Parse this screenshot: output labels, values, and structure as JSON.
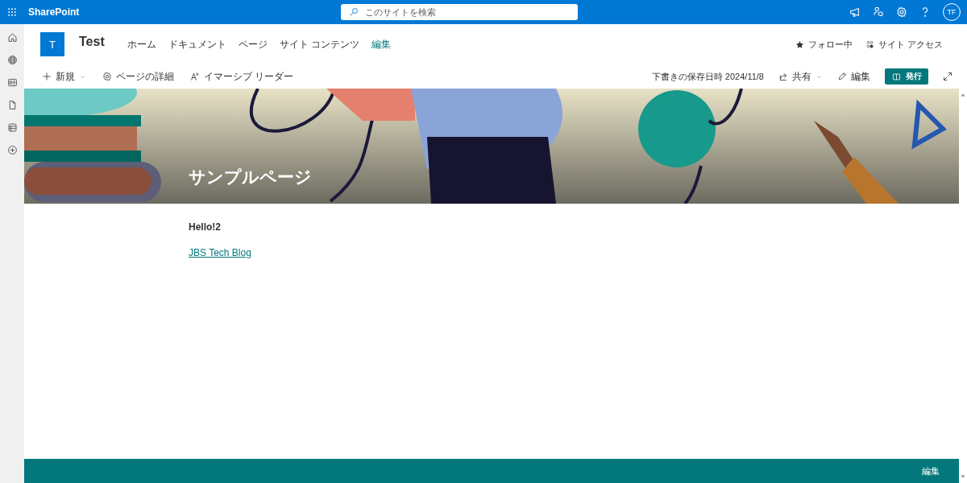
{
  "app_bar": {
    "brand": "SharePoint",
    "search": {
      "placeholder": "このサイトを検索"
    },
    "avatar": "TF"
  },
  "site": {
    "logo_letter": "T",
    "title": "Test",
    "nav": [
      {
        "label": "ホーム",
        "selected": false
      },
      {
        "label": "ドキュメント",
        "selected": false
      },
      {
        "label": "ページ",
        "selected": false
      },
      {
        "label": "サイト コンテンツ",
        "selected": false
      },
      {
        "label": "編集",
        "selected": true
      }
    ],
    "actions": [
      {
        "kind": "follow",
        "label": "フォロー中"
      },
      {
        "kind": "access",
        "label": "サイト アクセス"
      }
    ]
  },
  "command_bar": {
    "left": [
      {
        "kind": "new",
        "label": "新規",
        "dropdown": true
      },
      {
        "kind": "details",
        "label": "ページの詳細",
        "dropdown": false
      },
      {
        "kind": "reader",
        "label": "イマーシブ リーダー",
        "dropdown": false
      }
    ],
    "saved": "下書きの保存日時 2024/11/8",
    "right": [
      {
        "kind": "share",
        "label": "共有",
        "dropdown": true
      },
      {
        "kind": "edit",
        "label": "編集",
        "dropdown": false
      }
    ],
    "publish": "発行"
  },
  "hero": {
    "kind": "picture",
    "title": "サンプルページ"
  },
  "content": [
    {
      "kind": "heading",
      "text": "Hello!2"
    },
    {
      "kind": "link",
      "text": "JBS Tech Blog"
    }
  ],
  "footer": {
    "edit": "編集"
  }
}
